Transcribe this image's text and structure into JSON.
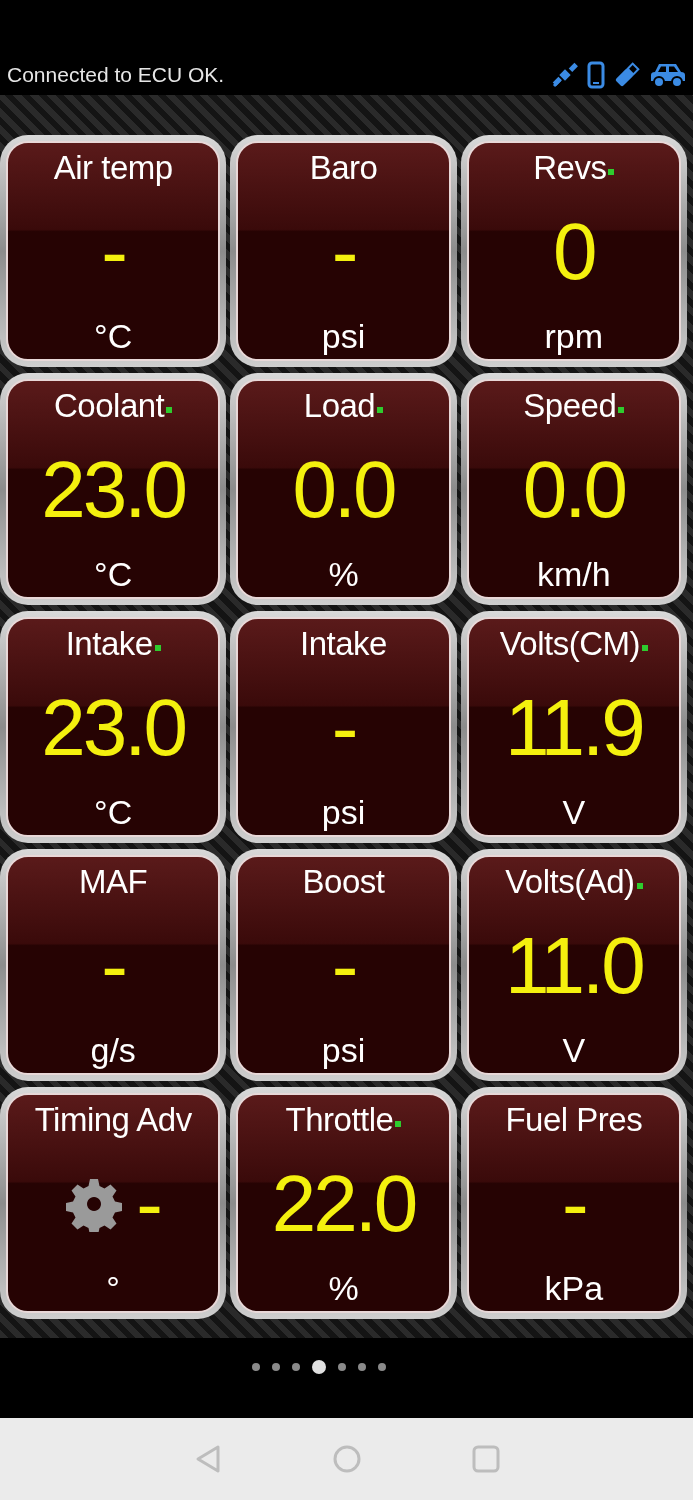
{
  "status_bar": {
    "message": "Connected to ECU OK."
  },
  "gauges": [
    {
      "label": "Air temp",
      "value": "-",
      "unit": "°C",
      "live": false
    },
    {
      "label": "Baro",
      "value": "-",
      "unit": "psi",
      "live": false
    },
    {
      "label": "Revs",
      "value": "0",
      "unit": "rpm",
      "live": true
    },
    {
      "label": "Coolant",
      "value": "23.0",
      "unit": "°C",
      "live": true
    },
    {
      "label": "Load",
      "value": "0.0",
      "unit": "%",
      "live": true
    },
    {
      "label": "Speed",
      "value": "0.0",
      "unit": "km/h",
      "live": true
    },
    {
      "label": "Intake",
      "value": "23.0",
      "unit": "°C",
      "live": true
    },
    {
      "label": "Intake",
      "value": "-",
      "unit": "psi",
      "live": false
    },
    {
      "label": "Volts(CM)",
      "value": "11.9",
      "unit": "V",
      "live": true
    },
    {
      "label": "MAF",
      "value": "-",
      "unit": "g/s",
      "live": false
    },
    {
      "label": "Boost",
      "value": "-",
      "unit": "psi",
      "live": false
    },
    {
      "label": "Volts(Ad)",
      "value": "11.0",
      "unit": "V",
      "live": true
    },
    {
      "label": "Timing Adv",
      "value": "-",
      "unit": "°",
      "live": false
    },
    {
      "label": "Throttle",
      "value": "22.0",
      "unit": "%",
      "live": true
    },
    {
      "label": "Fuel Pres",
      "value": "-",
      "unit": "kPa",
      "live": false
    }
  ],
  "pages": [
    {
      "selected": false
    },
    {
      "selected": false
    },
    {
      "selected": false
    },
    {
      "selected": true
    },
    {
      "selected": false
    },
    {
      "selected": false
    },
    {
      "selected": false
    }
  ]
}
